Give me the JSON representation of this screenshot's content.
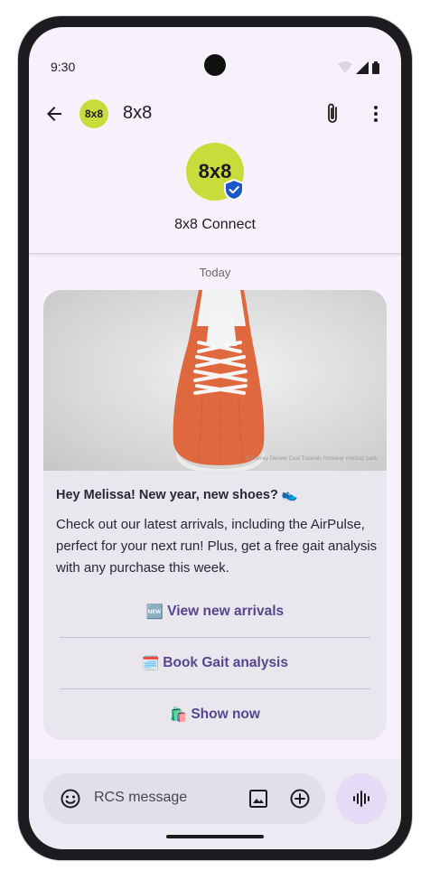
{
  "status": {
    "time": "9:30"
  },
  "header": {
    "avatar_text": "8x8",
    "title": "8x8"
  },
  "profile": {
    "avatar_text": "8x8",
    "name": "8x8 Connect"
  },
  "conversation": {
    "date_label": "Today"
  },
  "card": {
    "image_credit": "© Dorsey Denver Cost Tutorials footwear mockup pack",
    "heading": "Hey Melissa! New year, new shoes? 👟",
    "body": "Check out our latest arrivals, including the AirPulse, perfect for your next run! Plus, get a free gait analysis with any purchase this week.",
    "actions": [
      {
        "emoji": "🆕",
        "label": "View new arrivals"
      },
      {
        "emoji": "🗓️",
        "label": "Book Gait analysis"
      },
      {
        "emoji": "🛍️",
        "label": "Show now"
      }
    ]
  },
  "composer": {
    "placeholder": "RCS message"
  },
  "colors": {
    "accent": "#55478f",
    "brand_green": "#c8dc3c",
    "verified_blue": "#1a56c8",
    "shoe_orange": "#e0683e"
  },
  "icons": [
    "back-arrow-icon",
    "paperclip-icon",
    "more-vert-icon",
    "verified-badge-icon",
    "emoji-icon",
    "image-icon",
    "add-circle-icon",
    "voice-icon",
    "wifi-icon",
    "signal-icon",
    "battery-icon"
  ]
}
